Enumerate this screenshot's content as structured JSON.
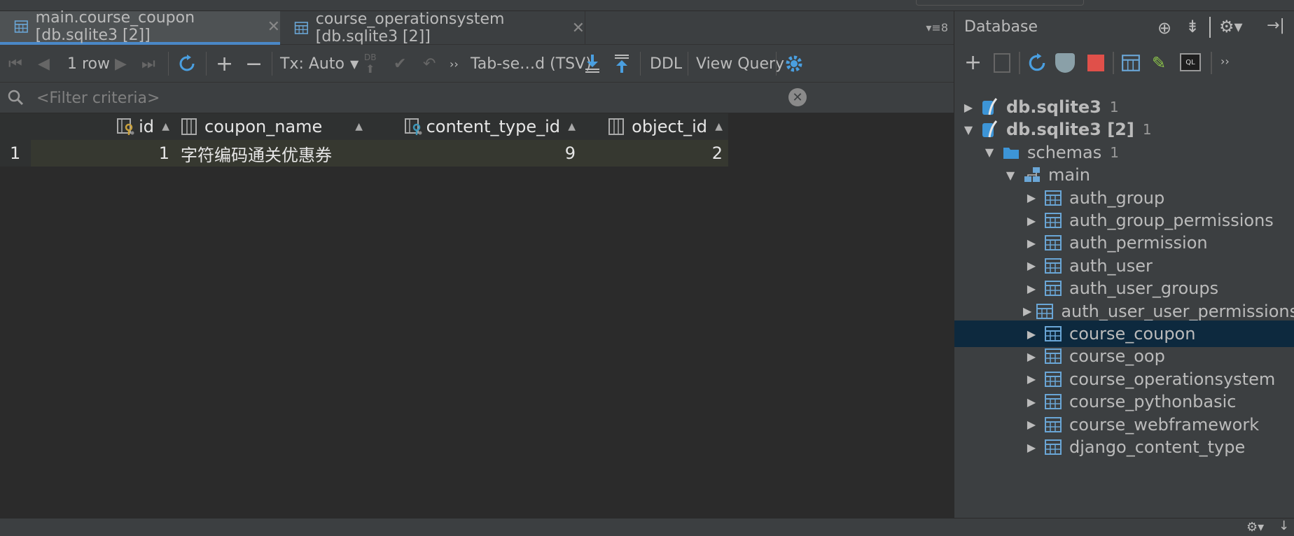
{
  "tabs": [
    {
      "label": "main.course_coupon [db.sqlite3 [2]]",
      "active": true
    },
    {
      "label": "course_operationsystem [db.sqlite3 [2]]",
      "active": false
    }
  ],
  "tab_overflow_count": "8",
  "toolbar": {
    "row_count": "1 row",
    "tx_mode": "Tx: Auto",
    "db_label": "DB",
    "extractor": "Tab-se…d (TSV)",
    "ddl": "DDL",
    "view_query": "View Query"
  },
  "filter": {
    "placeholder": "<Filter criteria>",
    "value": ""
  },
  "grid": {
    "columns": [
      {
        "name": "id",
        "icon": "primary-key-column-icon"
      },
      {
        "name": "coupon_name",
        "icon": "column-icon"
      },
      {
        "name": "content_type_id",
        "icon": "foreign-key-column-icon"
      },
      {
        "name": "object_id",
        "icon": "column-icon"
      }
    ],
    "rows": [
      {
        "num": "1",
        "id": "1",
        "coupon_name": "字符编码通关优惠券",
        "content_type_id": "9",
        "object_id": "2"
      }
    ]
  },
  "database_panel": {
    "title": "Database",
    "tree": [
      {
        "label": "db.sqlite3",
        "count": "1",
        "icon": "sqlite-icon",
        "level": 0,
        "expanded": false,
        "bold": true
      },
      {
        "label": "db.sqlite3 [2]",
        "count": "1",
        "icon": "sqlite-icon",
        "level": 0,
        "expanded": true,
        "bold": true
      },
      {
        "label": "schemas",
        "count": "1",
        "icon": "folder-icon",
        "level": 1,
        "expanded": true
      },
      {
        "label": "main",
        "count": "",
        "icon": "schema-icon",
        "level": 2,
        "expanded": true
      },
      {
        "label": "auth_group",
        "icon": "table-icon",
        "level": 3
      },
      {
        "label": "auth_group_permissions",
        "icon": "table-icon",
        "level": 3
      },
      {
        "label": "auth_permission",
        "icon": "table-icon",
        "level": 3
      },
      {
        "label": "auth_user",
        "icon": "table-icon",
        "level": 3
      },
      {
        "label": "auth_user_groups",
        "icon": "table-icon",
        "level": 3
      },
      {
        "label": "auth_user_user_permissions",
        "icon": "table-icon",
        "level": 3
      },
      {
        "label": "course_coupon",
        "icon": "table-icon",
        "level": 3,
        "selected": true
      },
      {
        "label": "course_oop",
        "icon": "table-icon",
        "level": 3
      },
      {
        "label": "course_operationsystem",
        "icon": "table-icon",
        "level": 3
      },
      {
        "label": "course_pythonbasic",
        "icon": "table-icon",
        "level": 3
      },
      {
        "label": "course_webframework",
        "icon": "table-icon",
        "level": 3
      },
      {
        "label": "django_content_type",
        "icon": "table-icon",
        "level": 3
      }
    ]
  },
  "colors": {
    "accent": "#4a88c7",
    "selection": "#0d293e",
    "key": "#c9a13c",
    "fk": "#3d95b7"
  }
}
